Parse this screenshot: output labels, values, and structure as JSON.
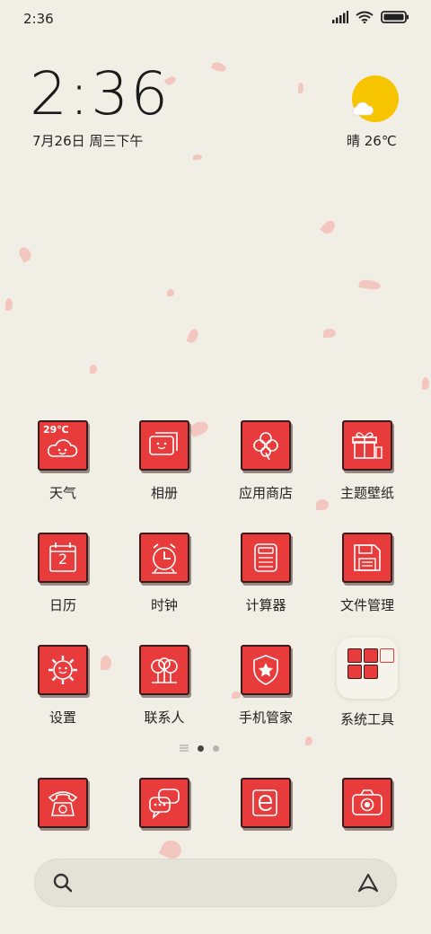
{
  "status_bar": {
    "time": "2:36"
  },
  "clock_widget": {
    "time": "2:36",
    "date": "7月26日 周三下午"
  },
  "weather_widget": {
    "text": "晴 26℃"
  },
  "apps": {
    "weather": {
      "label": "天气",
      "badge": "29℃"
    },
    "gallery": {
      "label": "相册"
    },
    "app_store": {
      "label": "应用商店"
    },
    "themes": {
      "label": "主题壁纸"
    },
    "calendar": {
      "label": "日历",
      "day": "2"
    },
    "clock": {
      "label": "时钟"
    },
    "calculator": {
      "label": "计算器"
    },
    "file_manager": {
      "label": "文件管理"
    },
    "settings": {
      "label": "设置"
    },
    "contacts": {
      "label": "联系人"
    },
    "security": {
      "label": "手机管家"
    },
    "tools_folder": {
      "label": "系统工具"
    }
  },
  "dock": [
    "phone",
    "messages",
    "browser",
    "camera"
  ],
  "pager": {
    "pages": 2,
    "current": 1
  },
  "colors": {
    "background": "#f1eee5",
    "tile": "#e83b3b",
    "sun": "#f7c500"
  }
}
